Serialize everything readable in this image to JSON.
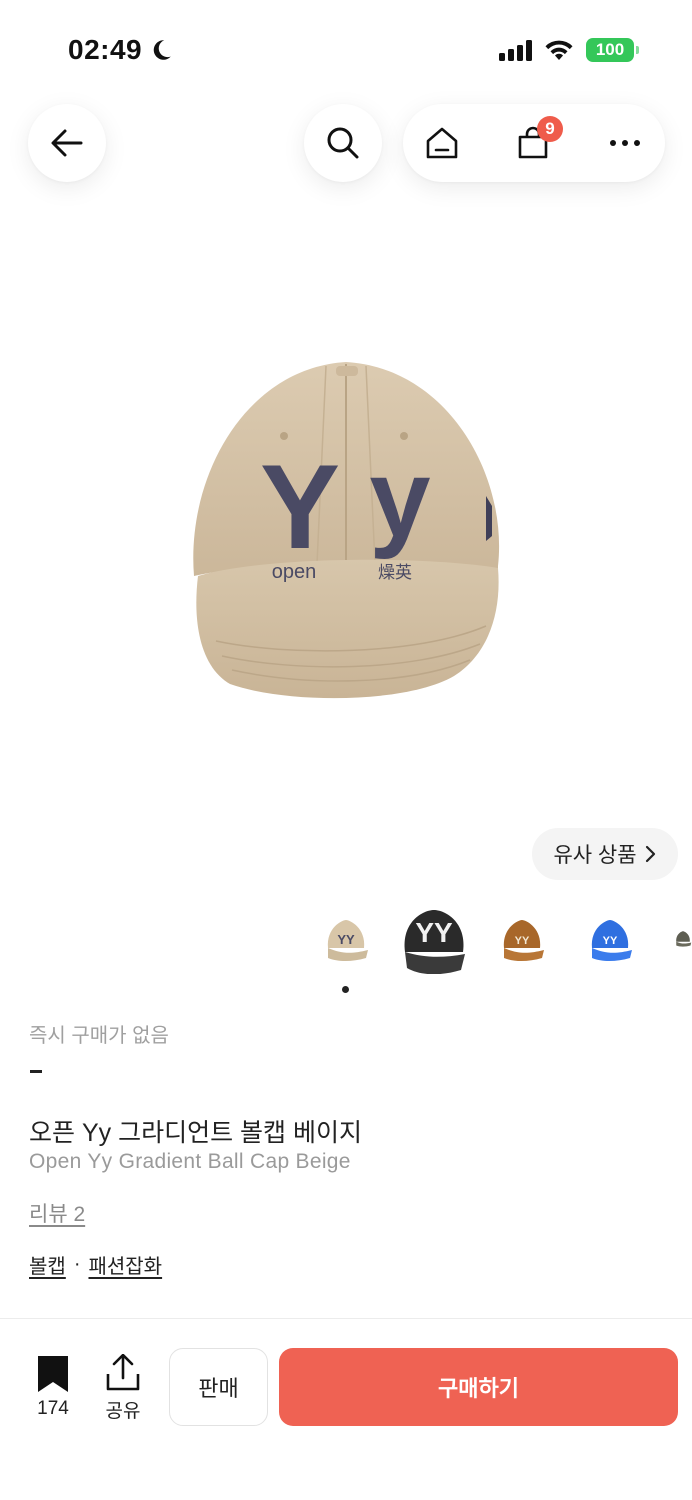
{
  "status_bar": {
    "time": "02:49",
    "battery": "100"
  },
  "nav": {
    "cart_badge": "9"
  },
  "product": {
    "similar_button": "유사 상품",
    "availability": "즉시 구매가 없음",
    "price": "-",
    "title_ko": "오픈 Yy 그라디언트 볼캡 베이지",
    "title_en": "Open Yy Gradient Ball Cap Beige",
    "review_link": "리뷰 2",
    "categories": [
      "볼캡",
      "패션잡화"
    ],
    "category_separator": "·",
    "image_text": {
      "letters": "Yy",
      "left_caption": "open",
      "right_caption": "燥英"
    }
  },
  "colors": {
    "accent": "#ef6253",
    "badge": "#ef5c4b",
    "battery": "#34c759"
  },
  "bottom_bar": {
    "bookmark_count": "174",
    "share_label": "공유",
    "sell_label": "판매",
    "buy_label": "구매하기"
  },
  "icons": [
    "back-arrow-icon",
    "search-icon",
    "home-icon",
    "shopping-bag-icon",
    "more-icon",
    "bookmark-icon",
    "share-icon",
    "chevron-right-icon"
  ]
}
